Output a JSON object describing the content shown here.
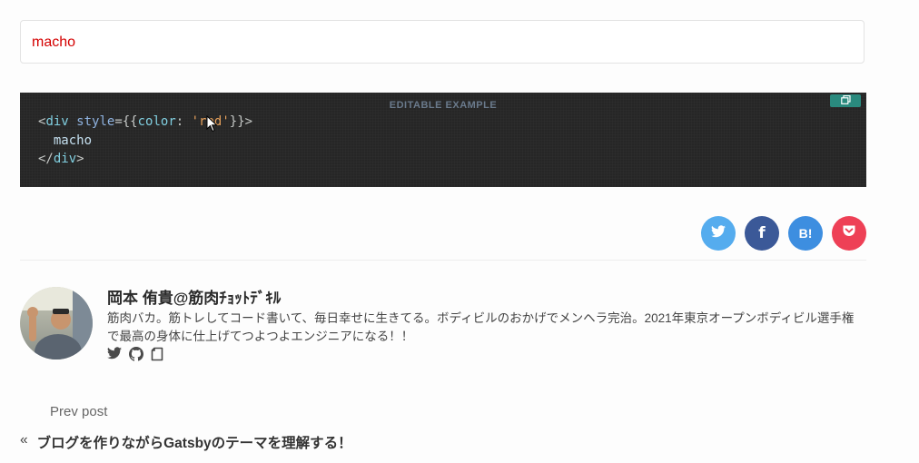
{
  "preview": {
    "text": "macho"
  },
  "editor": {
    "label": "EDITABLE EXAMPLE",
    "copy_icon": "copy-icon",
    "code": {
      "line1_open": "<",
      "line1_tag": "div",
      "line1_attr": " style",
      "line1_eq": "={{",
      "line1_key": "color",
      "line1_colon": ": ",
      "line1_value": "'red'",
      "line1_close": "}}>",
      "line2_text": "  macho",
      "line3_open": "</",
      "line3_tag": "div",
      "line3_close": ">"
    }
  },
  "share": [
    {
      "name": "twitter",
      "icon": "twitter-icon",
      "color": "#55acee"
    },
    {
      "name": "facebook",
      "icon": "facebook-icon",
      "label": "f",
      "color": "#3b5998"
    },
    {
      "name": "hatena",
      "icon": "hatena-bookmark-icon",
      "label": "B!",
      "color": "#3d8ee0"
    },
    {
      "name": "pocket",
      "icon": "pocket-icon",
      "color": "#ee4056"
    }
  ],
  "author": {
    "name": "岡本 侑貴@筋肉ﾁｮｯﾄﾃﾞｷﾙ",
    "bio": "筋肉バカ。筋トレしてコード書いて、毎日幸せに生きてる。ボディビルのおかげでメンヘラ完治。2021年東京オープンボディビル選手権で最高の身体に仕上げてつよつよエンジニアになる！！",
    "social_icons": [
      "twitter-icon",
      "github-icon",
      "blog-icon"
    ]
  },
  "nav": {
    "prev_label": "Prev post",
    "prev_arrow": "«",
    "prev_title": "ブログを作りながらGatsbyのテーマを理解する！"
  }
}
